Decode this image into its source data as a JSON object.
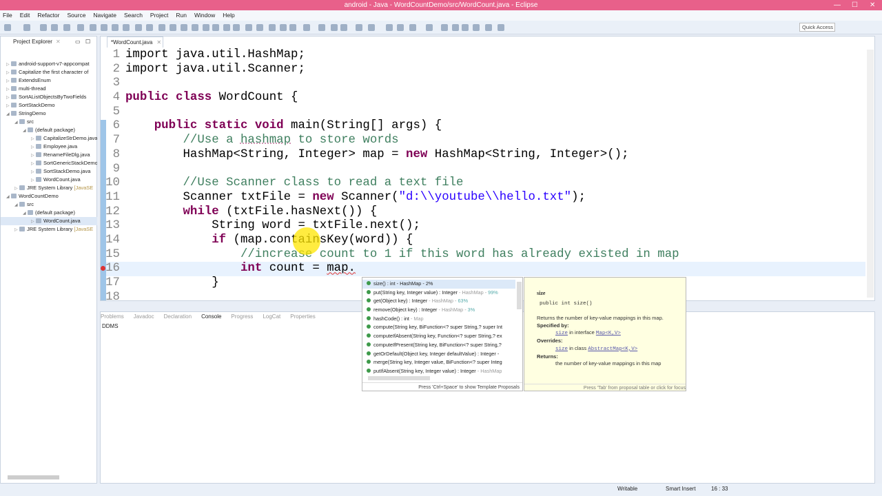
{
  "window": {
    "title": "android - Java - WordCountDemo/src/WordCount.java - Eclipse"
  },
  "menu": [
    "File",
    "Edit",
    "Refactor",
    "Source",
    "Navigate",
    "Search",
    "Project",
    "Run",
    "Window",
    "Help"
  ],
  "toolbar": {
    "quick_access": "Quick Access"
  },
  "project_explorer": {
    "title": "Project Explorer",
    "items": [
      {
        "label": "android-support-v7-appcompat",
        "depth": 0,
        "exp": "▷"
      },
      {
        "label": "Capitalize the first character of",
        "depth": 0,
        "exp": "▷"
      },
      {
        "label": "ExtendsEnum",
        "depth": 0,
        "exp": "▷"
      },
      {
        "label": "multi-thread",
        "depth": 0,
        "exp": "▷"
      },
      {
        "label": "SortAListObjectsByTwoFields",
        "depth": 0,
        "exp": "▷"
      },
      {
        "label": "SortStackDemo",
        "depth": 0,
        "exp": "▷"
      },
      {
        "label": "StringDemo",
        "depth": 0,
        "exp": "◢"
      },
      {
        "label": "src",
        "depth": 1,
        "exp": "◢"
      },
      {
        "label": "(default package)",
        "depth": 2,
        "exp": "◢"
      },
      {
        "label": "CapitalizeStrDemo.java",
        "depth": 3,
        "exp": "▷"
      },
      {
        "label": "Employee.java",
        "depth": 3,
        "exp": "▷"
      },
      {
        "label": "RenameFileDlg.java",
        "depth": 3,
        "exp": "▷"
      },
      {
        "label": "SortGenericStackDemo",
        "depth": 3,
        "exp": "▷"
      },
      {
        "label": "SortStackDemo.java",
        "depth": 3,
        "exp": "▷"
      },
      {
        "label": "WordCount.java",
        "depth": 3,
        "exp": "▷"
      },
      {
        "label": "JRE System Library",
        "suffix": " [JavaSE",
        "depth": 1,
        "exp": "▷"
      },
      {
        "label": "WordCountDemo",
        "depth": 0,
        "exp": "◢"
      },
      {
        "label": "src",
        "depth": 1,
        "exp": "◢"
      },
      {
        "label": "(default package)",
        "depth": 2,
        "exp": "◢"
      },
      {
        "label": "WordCount.java",
        "depth": 3,
        "exp": "▷",
        "selected": true
      },
      {
        "label": "JRE System Library",
        "suffix": " [JavaSE",
        "depth": 1,
        "exp": "▷"
      }
    ]
  },
  "editor": {
    "tab": "*WordCount.java",
    "lines": [
      [
        [
          "",
          "import java.util.HashMap;"
        ]
      ],
      [
        [
          "",
          "import java.util.Scanner;"
        ]
      ],
      [],
      [
        [
          "kw",
          "public class"
        ],
        [
          "",
          " WordCount {"
        ]
      ],
      [],
      [
        [
          "",
          "    "
        ],
        [
          "kw",
          "public static void"
        ],
        [
          "",
          " main(String[] args) {"
        ]
      ],
      [
        [
          "cm",
          "        //Use a "
        ],
        [
          "cm sq",
          "hashmap"
        ],
        [
          "cm",
          " to store words"
        ]
      ],
      [
        [
          "",
          "        HashMap<String, Integer> map = "
        ],
        [
          "kw",
          "new"
        ],
        [
          "",
          " HashMap<String, Integer>();"
        ]
      ],
      [],
      [
        [
          "cm",
          "        //Use Scanner class to read a text file"
        ]
      ],
      [
        [
          "",
          "        Scanner txtFile = "
        ],
        [
          "kw",
          "new"
        ],
        [
          "",
          " Scanner("
        ],
        [
          "st",
          "\"d:\\\\youtube\\\\hello.txt\""
        ],
        [
          "",
          ");"
        ]
      ],
      [
        [
          "",
          "        "
        ],
        [
          "kw",
          "while"
        ],
        [
          "",
          " (txtFile.hasNext()) {"
        ]
      ],
      [
        [
          "",
          "            String word = txtFile.next();"
        ]
      ],
      [
        [
          "",
          "            "
        ],
        [
          "kw",
          "if"
        ],
        [
          "",
          " (map.containsKey(word)) {"
        ]
      ],
      [
        [
          "cm",
          "                //increase count to 1 if this word has already existed in map"
        ]
      ],
      [
        [
          "",
          "                "
        ],
        [
          "kw",
          "int"
        ],
        [
          "",
          " count = "
        ],
        [
          "wavy",
          "map."
        ]
      ],
      [
        [
          "",
          "            }"
        ]
      ],
      [
        [
          "",
          ""
        ]
      ]
    ]
  },
  "bottom": {
    "tabs": [
      "Problems",
      "Javadoc",
      "Declaration",
      "Console",
      "Progress",
      "LogCat",
      "Properties"
    ],
    "active": "Console",
    "console_text": "DDMS"
  },
  "proposals": {
    "items": [
      {
        "main": "size() : int - HashMap - 2%",
        "gray": "",
        "tail": ""
      },
      {
        "main": "put(String key, Integer value) : Integer",
        "gray": " - HashMap - ",
        "tail": "99%"
      },
      {
        "main": "get(Object key) : Integer",
        "gray": " - HashMap - ",
        "tail": "63%"
      },
      {
        "main": "remove(Object key) : Integer",
        "gray": " - HashMap - ",
        "tail": "3%"
      },
      {
        "main": "hashCode() : int",
        "gray": " - Map",
        "tail": ""
      },
      {
        "main": "compute(String key, BiFunction<? super String,? super Int",
        "gray": "",
        "tail": ""
      },
      {
        "main": "computeIfAbsent(String key, Function<? super String,? ex",
        "gray": "",
        "tail": ""
      },
      {
        "main": "computeIfPresent(String key, BiFunction<? super String,?",
        "gray": "",
        "tail": ""
      },
      {
        "main": "getOrDefault(Object key, Integer defaultValue) : Integer -",
        "gray": "",
        "tail": ""
      },
      {
        "main": "merge(String key, Integer value, BiFunction<? super Integ",
        "gray": "",
        "tail": ""
      },
      {
        "main": "putIfAbsent(String key, Integer value) : Integer",
        "gray": " - HashMap",
        "tail": ""
      }
    ],
    "footer": "Press 'Ctrl+Space' to show Template Proposals"
  },
  "doc": {
    "title": "size",
    "signature": "public int size()",
    "desc": "Returns the number of key-value mappings in this map.",
    "specified_label": "Specified by:",
    "spec_link": "size",
    "spec_mid": " in interface ",
    "spec_type": "Map<K,V>",
    "overrides_label": "Overrides:",
    "ov_link": "size",
    "ov_mid": " in class ",
    "ov_type": "AbstractMap<K,V>",
    "returns_label": "Returns:",
    "returns": "the number of key-value mappings in this map",
    "footer": "Press 'Tab' from proposal table or click for focus"
  },
  "status": {
    "writable": "Writable",
    "insert": "Smart Insert",
    "position": "16 : 33"
  }
}
